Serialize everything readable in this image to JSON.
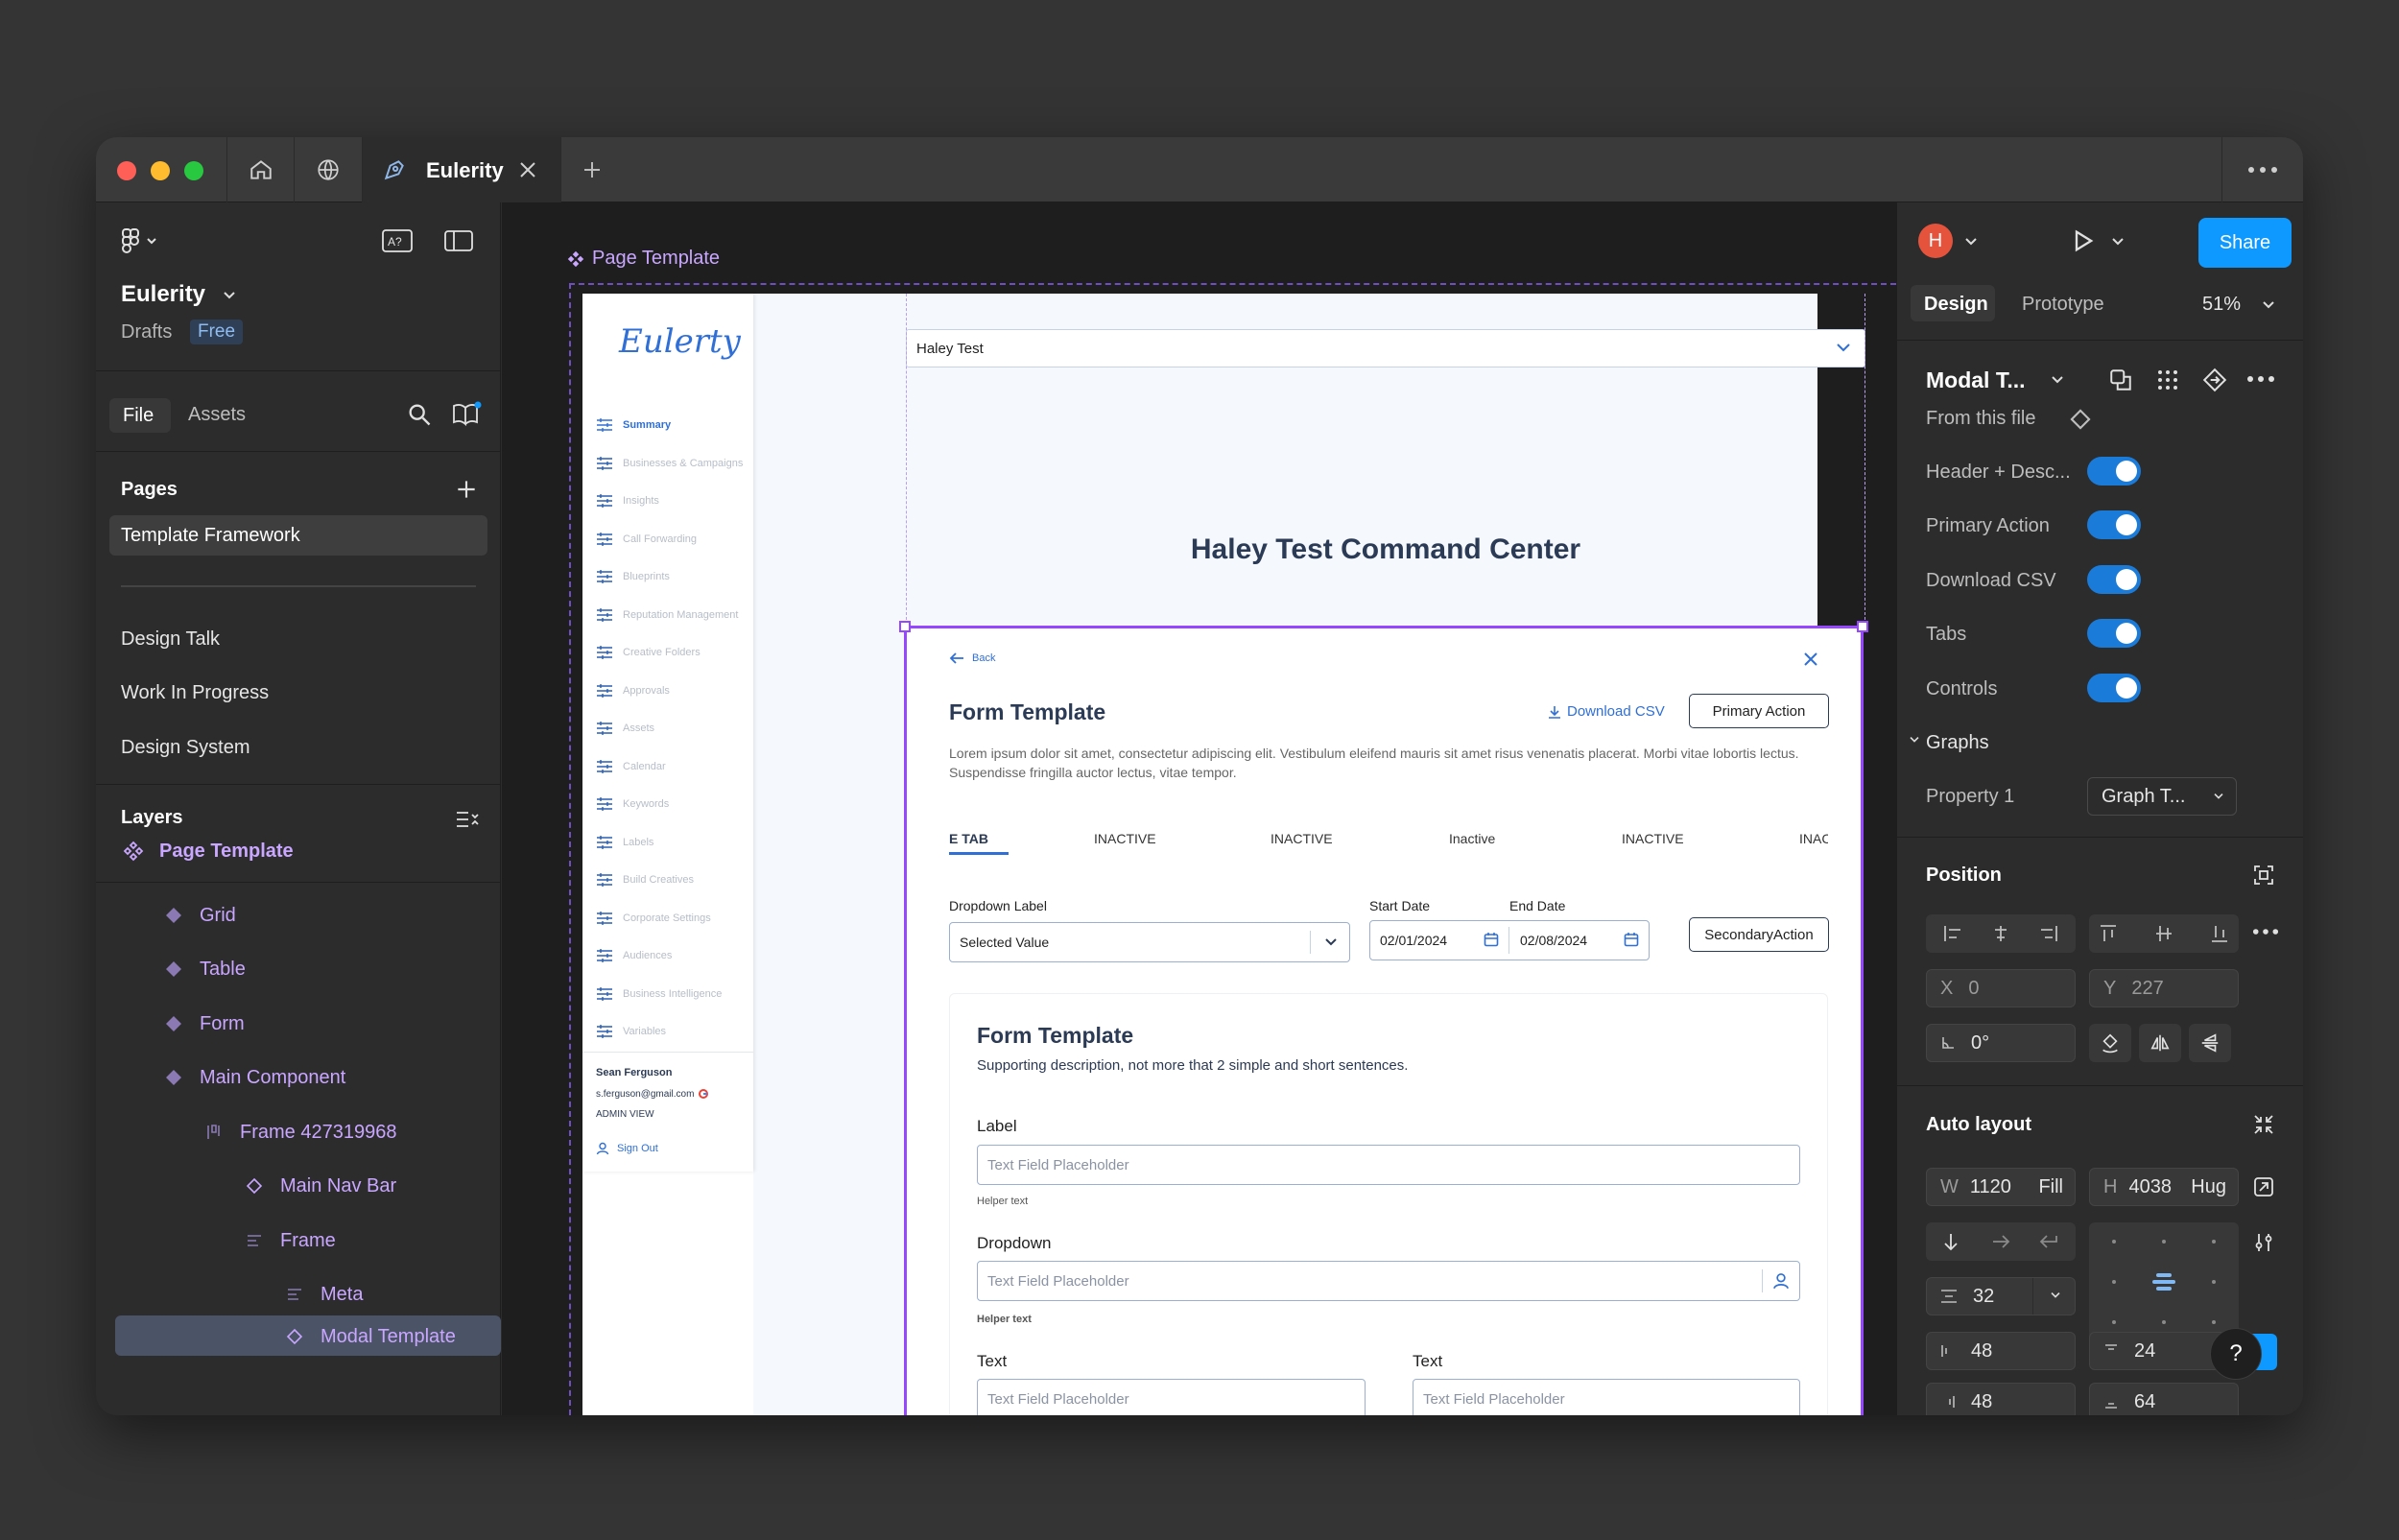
{
  "window": {
    "tab_title": "Eulerity"
  },
  "left_panel": {
    "file_name": "Eulerity",
    "location": "Drafts",
    "plan_badge": "Free",
    "tabs": {
      "file": "File",
      "assets": "Assets"
    },
    "pages_heading": "Pages",
    "pages": [
      "Template Framework",
      "Design Talk",
      "Work In Progress",
      "Design System"
    ],
    "layers_heading": "Layers",
    "layers": [
      {
        "name": "Page Template",
        "icon": "component-set-icon"
      },
      {
        "name": "Grid",
        "icon": "instance-icon"
      },
      {
        "name": "Table",
        "icon": "instance-icon"
      },
      {
        "name": "Form",
        "icon": "instance-icon"
      },
      {
        "name": "Main Component",
        "icon": "instance-icon"
      },
      {
        "name": "Frame 427319968",
        "icon": "frame-autolayout-icon"
      },
      {
        "name": "Main Nav Bar",
        "icon": "instance-outline-icon"
      },
      {
        "name": "Frame",
        "icon": "autolayout-icon"
      },
      {
        "name": "Meta",
        "icon": "autolayout-icon"
      },
      {
        "name": "Modal Template",
        "icon": "instance-outline-icon"
      }
    ]
  },
  "canvas": {
    "frame_label": "Page Template",
    "design": {
      "logo": "Eulerty",
      "nav_items": [
        "Summary",
        "Businesses & Campaigns",
        "Insights",
        "Call Forwarding",
        "Blueprints",
        "Reputation Management",
        "Creative Folders",
        "Approvals",
        "Assets",
        "Calendar",
        "Keywords",
        "Labels",
        "Build Creatives",
        "Corporate Settings",
        "Audiences",
        "Business Intelligence",
        "Variables"
      ],
      "user_name": "Sean Ferguson",
      "user_email": "s.ferguson@gmail.com",
      "user_role": "ADMIN VIEW",
      "sign_out": "Sign Out",
      "account_select": "Haley Test",
      "page_title": "Haley Test Command Center",
      "back": "Back",
      "modal_title": "Form Template",
      "download_csv": "Download CSV",
      "primary_action": "Primary Action",
      "description": "Lorem ipsum dolor sit amet, consectetur adipiscing elit. Vestibulum eleifend mauris sit amet risus venenatis placerat. Morbi vitae lobortis lectus. Suspendisse fringilla auctor lectus, vitae tempor.",
      "tabs": [
        "E TAB",
        "INACTIVE",
        "INACTIVE",
        "Inactive",
        "INACTIVE",
        "INAC"
      ],
      "dropdown_label": "Dropdown Label",
      "dropdown_value": "Selected Value",
      "start_date_label": "Start Date",
      "start_date": "02/01/2024",
      "end_date_label": "End Date",
      "end_date": "02/08/2024",
      "secondary_action": "SecondaryAction",
      "card_title": "Form Template",
      "card_desc": "Supporting description, not more that 2 simple and short sentences.",
      "label_1": "Label",
      "placeholder": "Text Field Placeholder",
      "helper": "Helper text",
      "label_2": "Dropdown",
      "label_3": "Text",
      "label_4": "Text"
    }
  },
  "right_panel": {
    "avatar_initial": "H",
    "share": "Share",
    "tabs": {
      "design": "Design",
      "prototype": "Prototype"
    },
    "zoom": "51%",
    "component_name": "Modal T...",
    "from_file": "From this file",
    "properties": [
      {
        "label": "Header + Desc...",
        "on": true
      },
      {
        "label": "Primary Action",
        "on": true
      },
      {
        "label": "Download CSV",
        "on": true
      },
      {
        "label": "Tabs",
        "on": true
      },
      {
        "label": "Controls",
        "on": true
      }
    ],
    "graphs_heading": "Graphs",
    "property_1_label": "Property 1",
    "property_1_value": "Graph T...",
    "position_heading": "Position",
    "x_label": "X",
    "x_value": "0",
    "y_label": "Y",
    "y_value": "227",
    "rotation": "0°",
    "auto_layout_heading": "Auto layout",
    "w_label": "W",
    "w_value": "1120",
    "w_mode": "Fill",
    "h_label": "H",
    "h_value": "4038",
    "h_mode": "Hug",
    "gap": "32",
    "padding_left": "48",
    "padding_top": "24",
    "padding_right": "48",
    "padding_bottom": "64",
    "help": "?"
  },
  "colors": {
    "accent": "#0d99ff",
    "component": "#9747ff",
    "layer_text": "#c9a6ff",
    "toggle_on": "#1b7bd9"
  }
}
